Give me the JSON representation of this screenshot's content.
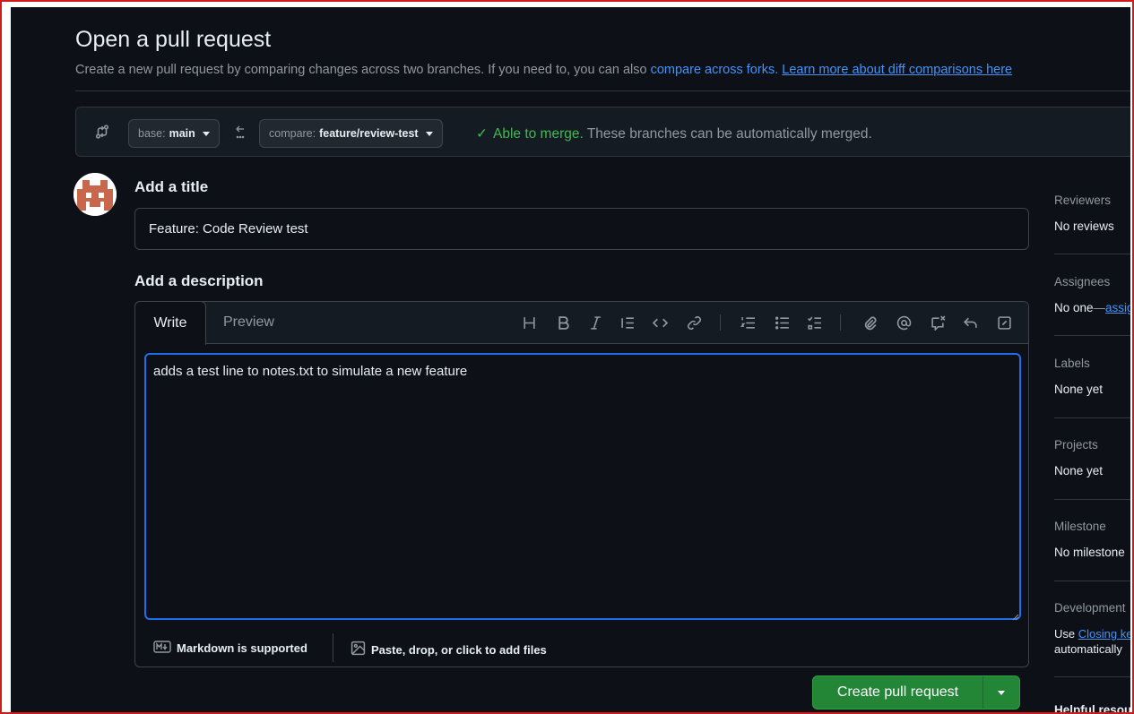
{
  "page": {
    "title": "Open a pull request",
    "subtitle_prefix": "Create a new pull request by comparing changes across two branches. If you need to, you can also ",
    "subtitle_link1": "compare across forks.",
    "subtitle_link2": "Learn more about diff comparisons here"
  },
  "compare": {
    "base_prefix": "base:",
    "base_branch": "main",
    "compare_prefix": "compare:",
    "compare_branch": "feature/review-test",
    "merge_ok": "Able to merge.",
    "merge_msg": " These branches can be automatically merged."
  },
  "form": {
    "title_label": "Add a title",
    "title_value": "Feature: Code Review test",
    "desc_label": "Add a description",
    "tab_write": "Write",
    "tab_preview": "Preview",
    "desc_value": "adds a test line to notes.txt to simulate a new feature",
    "markdown_note": "Markdown is supported",
    "attach_note": "Paste, drop, or click to add files",
    "submit_label": "Create pull request"
  },
  "toolbar": {
    "icons": [
      "heading-icon",
      "bold-icon",
      "italic-icon",
      "quote-icon",
      "code-icon",
      "link-icon",
      "numbered-list-icon",
      "unordered-list-icon",
      "task-list-icon",
      "attach-icon",
      "mention-icon",
      "cross-reference-icon",
      "reply-icon",
      "fullscreen-icon"
    ]
  },
  "sidebar": {
    "reviewers_label": "Reviewers",
    "reviewers_value": "No reviews",
    "assignees_label": "Assignees",
    "assignees_value": "No one",
    "assignees_dash": "—",
    "assignees_link": "assign yourself",
    "labels_label": "Labels",
    "labels_value": "None yet",
    "projects_label": "Projects",
    "projects_value": "None yet",
    "milestone_label": "Milestone",
    "milestone_value": "No milestone",
    "development_label": "Development",
    "development_prefix": "Use ",
    "development_link": "Closing keywords",
    "development_suffix": "automatically",
    "helpful_label": "Helpful resources"
  },
  "colors": {
    "background": "#0d1117",
    "accent_link": "#4493f8",
    "success": "#3fb950",
    "primary_button": "#238636",
    "frame_border": "#d11a1a"
  }
}
